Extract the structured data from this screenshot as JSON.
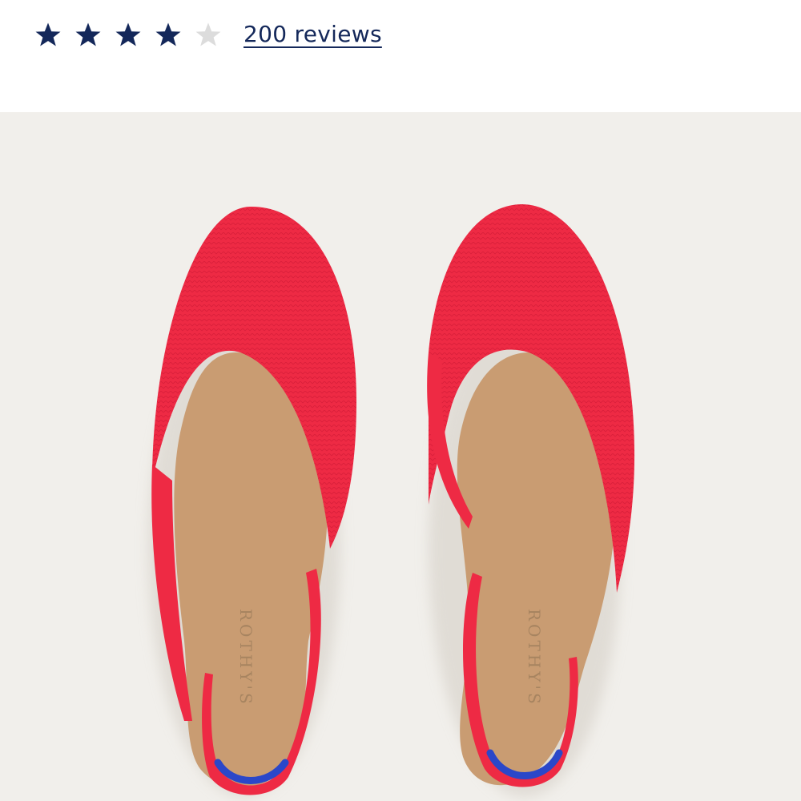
{
  "rating": {
    "value": 4,
    "max": 5,
    "filled_color": "#14285a",
    "empty_color": "#dcdcdc",
    "reviews_label": "200 reviews"
  },
  "product_image": {
    "background": "#f1efeb",
    "shoe_color": "#ef2b45",
    "insole_color": "#c79a72",
    "heel_accent_color": "#2b47c9",
    "insole_brand": "ROTHY'S"
  }
}
